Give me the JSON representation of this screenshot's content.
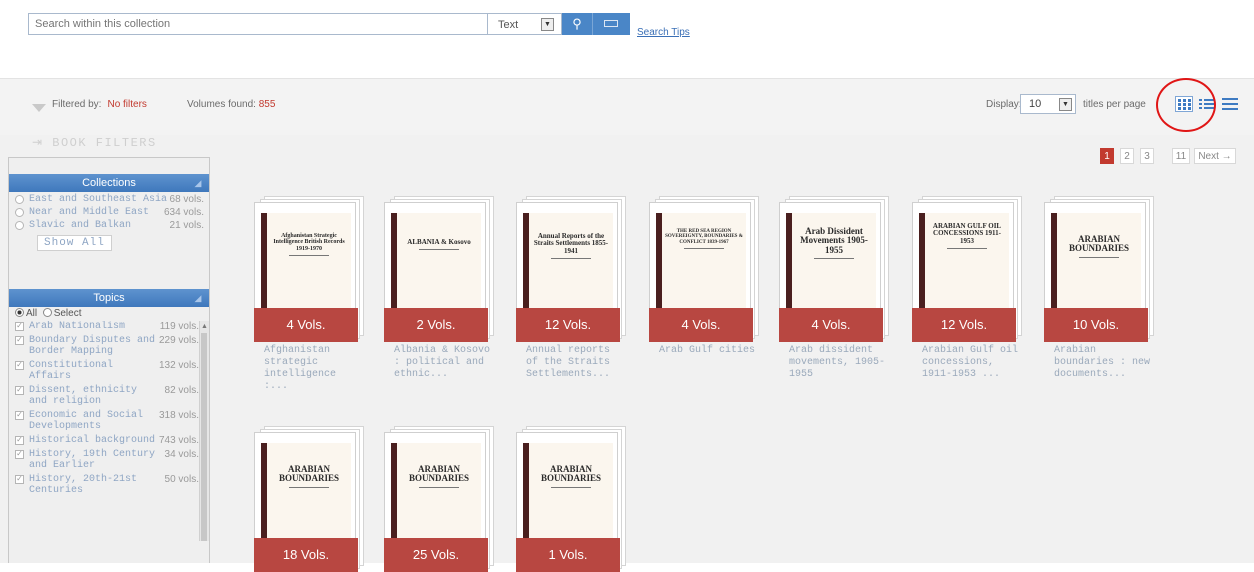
{
  "search": {
    "placeholder": "Search within this collection",
    "type_value": "Text",
    "tips_label": "Search Tips",
    "search_icon": "magnifier-icon",
    "keyboard_icon": "keyboard-icon"
  },
  "filterbar": {
    "filtered_by_label": "Filtered by:",
    "filtered_by_value": "No filters",
    "volumes_label": "Volumes found:",
    "volumes_value": "855",
    "display_label": "Display:",
    "display_value": "10",
    "titles_per_page": "titles per page"
  },
  "sidebar": {
    "heading": "BOOK FILTERS",
    "collections_title": "Collections",
    "collections": [
      {
        "label": "East and Southeast Asia",
        "count": "68 vols."
      },
      {
        "label": "Near and Middle East",
        "count": "634 vols."
      },
      {
        "label": "Slavic and Balkan",
        "count": "21 vols."
      }
    ],
    "show_all": "Show All",
    "topics_title": "Topics",
    "topics_all": "All",
    "topics_select": "Select",
    "topics": [
      {
        "label": "Arab Nationalism",
        "count": "119 vols."
      },
      {
        "label": "Boundary Disputes and Border Mapping",
        "count": "229 vols."
      },
      {
        "label": "Constitutional Affairs",
        "count": "132 vols."
      },
      {
        "label": "Dissent, ethnicity and religion",
        "count": "82 vols."
      },
      {
        "label": "Economic and Social Developments",
        "count": "318 vols."
      },
      {
        "label": "Historical background",
        "count": "743 vols."
      },
      {
        "label": "History, 19th Century and Earlier",
        "count": "34 vols."
      },
      {
        "label": "History, 20th-21st Centuries",
        "count": "50 vols."
      }
    ]
  },
  "pager": {
    "pages": [
      "1",
      "2",
      "3"
    ],
    "last": "11",
    "next": "Next →"
  },
  "books": [
    {
      "vols": "4 Vols.",
      "title": "Afghanistan strategic intelligence :...",
      "cover": "Afghanistan Strategic Intelligence British Records 1919-1970"
    },
    {
      "vols": "2 Vols.",
      "title": "Albania & Kosovo : political and ethnic...",
      "cover": "ALBANIA & Kosovo"
    },
    {
      "vols": "12 Vols.",
      "title": "Annual reports of the Straits Settlements...",
      "cover": "Annual Reports of the Straits Settlements 1855-1941"
    },
    {
      "vols": "4 Vols.",
      "title": "Arab Gulf cities",
      "cover": "THE RED SEA REGION SOVEREIGNTY, BOUNDARIES & CONFLICT 1839-1967"
    },
    {
      "vols": "4 Vols.",
      "title": "Arab dissident movements, 1905-1955",
      "cover": "Arab Dissident Movements 1905-1955"
    },
    {
      "vols": "12 Vols.",
      "title": "Arabian Gulf oil concessions, 1911-1953 ...",
      "cover": "ARABIAN GULF OIL CONCESSIONS 1911-1953"
    },
    {
      "vols": "10 Vols.",
      "title": "Arabian boundaries : new documents...",
      "cover": "ARABIAN BOUNDARIES"
    },
    {
      "vols": "18 Vols.",
      "title": "",
      "cover": "ARABIAN BOUNDARIES"
    },
    {
      "vols": "25 Vols.",
      "title": "",
      "cover": "ARABIAN BOUNDARIES"
    },
    {
      "vols": "1 Vols.",
      "title": "",
      "cover": "ARABIAN BOUNDARIES"
    }
  ]
}
